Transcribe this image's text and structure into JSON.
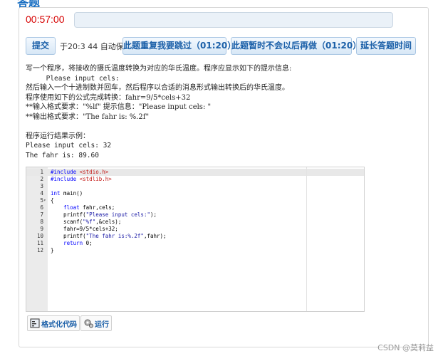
{
  "header": {
    "title_fragment": "答题"
  },
  "timer": {
    "value": "00:57:00"
  },
  "progress": {
    "fraction": 0.0
  },
  "toolbar": {
    "submit_label": "提交",
    "autosave_text": "于20:3 44 自动保存.",
    "skip_repeat_label": "此题重复我要跳过（01:20）",
    "later_label": "此题暂时不会以后再做（01:20）",
    "extend_label": "延长答题时间"
  },
  "problem": {
    "lines": [
      "写一个程序，将接收的摄氏温度转换为对应的华氏温度。程序应显示如下的提示信息:",
      "     Please input cels:",
      "然后输入一个十进制数并回车，然后程序以合适的消息形式输出转换后的华氏温度。",
      "程序使用如下的公式完成转换：fahr=9/5*cels+32",
      "**输入格式要求：\"%lf\" 提示信息：\"Please input cels: \"",
      "**输出格式要求：\"The fahr is: %.2f\"",
      "",
      "程序运行结果示例：",
      "Please input cels: 32",
      "The fahr is: 89.60"
    ]
  },
  "editor": {
    "lines": [
      {
        "n": "1",
        "fold": "",
        "text": "#include <stdio.h>"
      },
      {
        "n": "2",
        "fold": "",
        "text": "#include <stdlib.h>"
      },
      {
        "n": "3",
        "fold": "",
        "text": ""
      },
      {
        "n": "4",
        "fold": "",
        "text": "int main()"
      },
      {
        "n": "5",
        "fold": "▾",
        "text": "{"
      },
      {
        "n": "6",
        "fold": "",
        "text": "    float fahr,cels;"
      },
      {
        "n": "7",
        "fold": "",
        "text": "    printf(\"Please input cels:\");"
      },
      {
        "n": "8",
        "fold": "",
        "text": "    scanf(\"%f\",&cels);"
      },
      {
        "n": "9",
        "fold": "",
        "text": "    fahr=9/5*cels+32;"
      },
      {
        "n": "10",
        "fold": "",
        "text": "    printf(\"The fahr is:%.2f\",fahr);"
      },
      {
        "n": "11",
        "fold": "",
        "text": "    return 0;"
      },
      {
        "n": "12",
        "fold": "",
        "text": "}"
      }
    ]
  },
  "actions": {
    "format_label": "格式化代码",
    "run_label": "运行"
  },
  "watermark": {
    "text": "CSDN @莫莉益"
  },
  "colors": {
    "accent": "#1a5fa8",
    "timer": "#d60000"
  }
}
